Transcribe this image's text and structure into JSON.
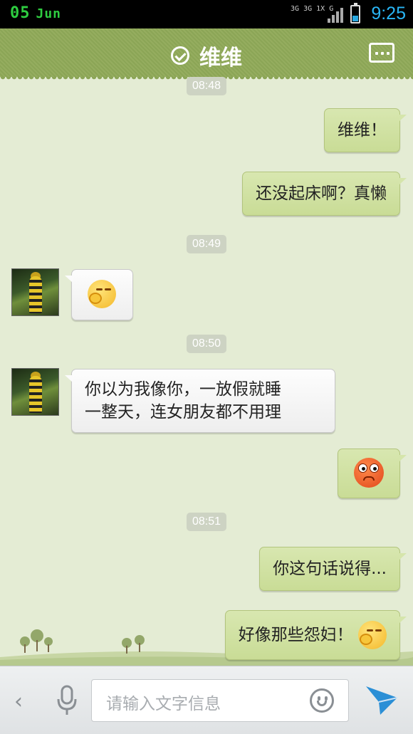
{
  "status_bar": {
    "day": "05",
    "month": "Jun",
    "networks": [
      "3G",
      "3G",
      "1X",
      "G"
    ],
    "time": "9:25",
    "battery_level": 0.35
  },
  "header": {
    "title": "维维",
    "accent_color": "#8fa85a"
  },
  "chat": {
    "timestamps": [
      "08:48",
      "08:49",
      "08:50",
      "08:51"
    ],
    "messages": [
      {
        "side": "out",
        "text": "维维！"
      },
      {
        "side": "out",
        "text": "还没起床啊？真懒"
      },
      {
        "side": "in",
        "emoji": "shy-face-icon"
      },
      {
        "side": "in",
        "line1": "你以为我像你，一放假就睡",
        "line2": "一整天，连女朋友都不用理"
      },
      {
        "side": "out",
        "emoji": "angry-face-icon"
      },
      {
        "side": "out",
        "text": "你这句话说得..."
      },
      {
        "side": "out",
        "text": "好像那些怨妇！",
        "emoji": "shy-face-icon"
      }
    ]
  },
  "input_bar": {
    "placeholder": "请输入文字信息"
  },
  "colors": {
    "outgoing_bubble": "#d2e2a6",
    "incoming_bubble": "#f7f7f7",
    "background": "#e4ecd4",
    "send": "#2b8fd6"
  }
}
